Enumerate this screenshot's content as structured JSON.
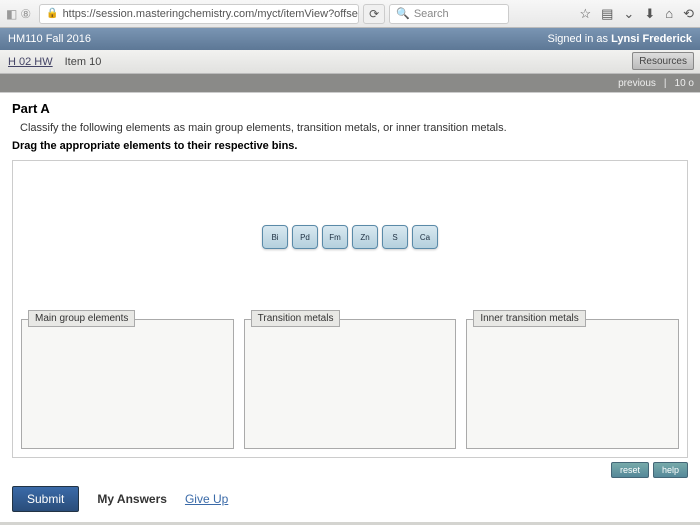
{
  "browser": {
    "url": "https://session.masteringchemistry.com/myct/itemView?offse",
    "search_placeholder": "Search"
  },
  "course": {
    "title": "HM110 Fall 2016",
    "signed_in_prefix": "Signed in as",
    "signed_in_user": "Lynsi Frederick"
  },
  "nav": {
    "hw_link": "H 02 HW",
    "item": "Item 10",
    "resources": "Resources",
    "previous": "previous",
    "counter": "10 o"
  },
  "part": {
    "title": "Part A",
    "instruction": "Classify the following elements as main group elements, transition metals, or inner transition metals.",
    "drag_instruction": "Drag the appropriate elements to their respective bins."
  },
  "chips": [
    "Bi",
    "Pd",
    "Fm",
    "Zn",
    "S",
    "Ca"
  ],
  "bins": [
    {
      "label": "Main group elements"
    },
    {
      "label": "Transition metals"
    },
    {
      "label": "Inner transition metals"
    }
  ],
  "tools": {
    "reset": "reset",
    "help": "help"
  },
  "footer": {
    "submit": "Submit",
    "my_answers": "My Answers",
    "give_up": "Give Up"
  }
}
